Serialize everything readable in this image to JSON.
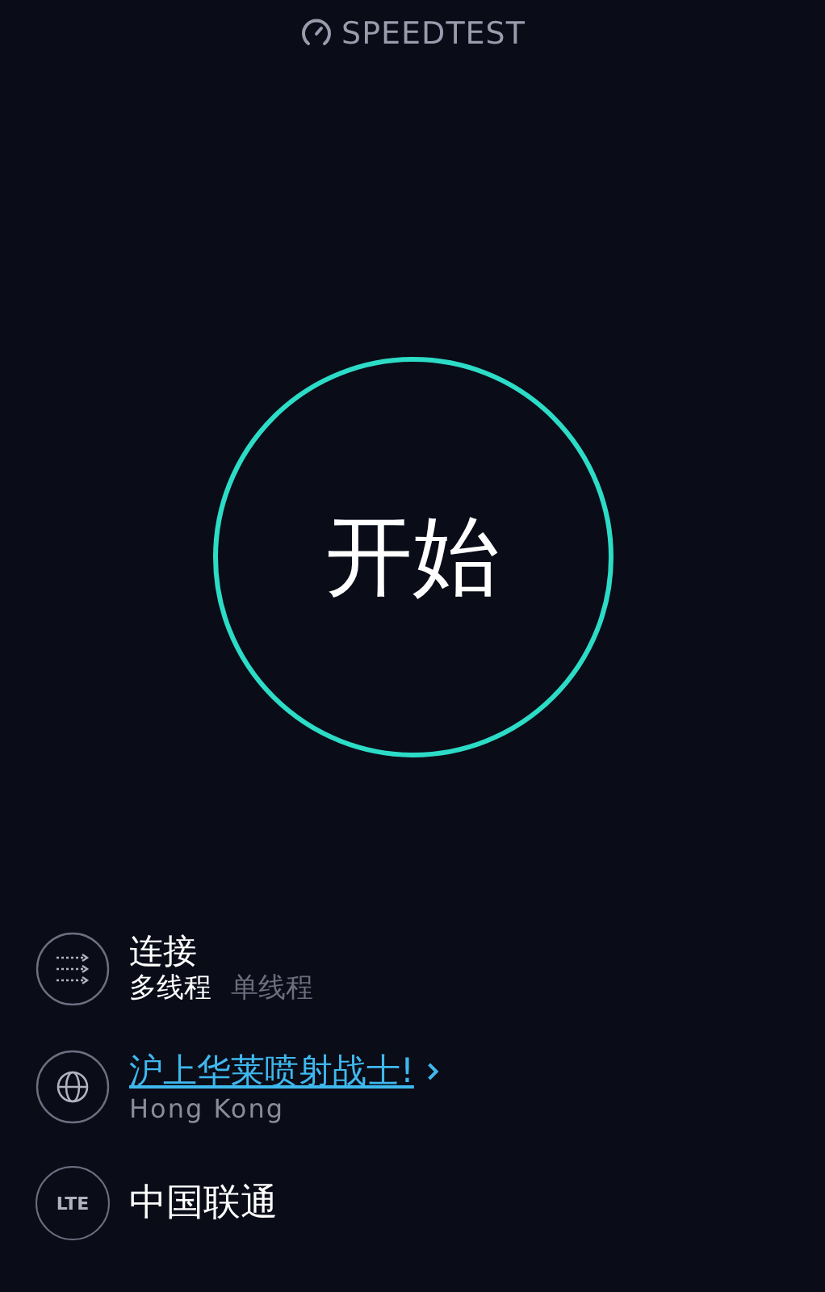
{
  "header": {
    "title": "SPEEDTEST"
  },
  "start_button": {
    "label": "开始"
  },
  "connection": {
    "title": "连接",
    "modes": [
      {
        "label": "多线程",
        "selected": true
      },
      {
        "label": "单线程",
        "selected": false
      }
    ]
  },
  "server": {
    "name": "沪上华莱喷射战士!",
    "location": "Hong Kong"
  },
  "carrier": {
    "badge": "LTE",
    "name": "中国联通"
  }
}
